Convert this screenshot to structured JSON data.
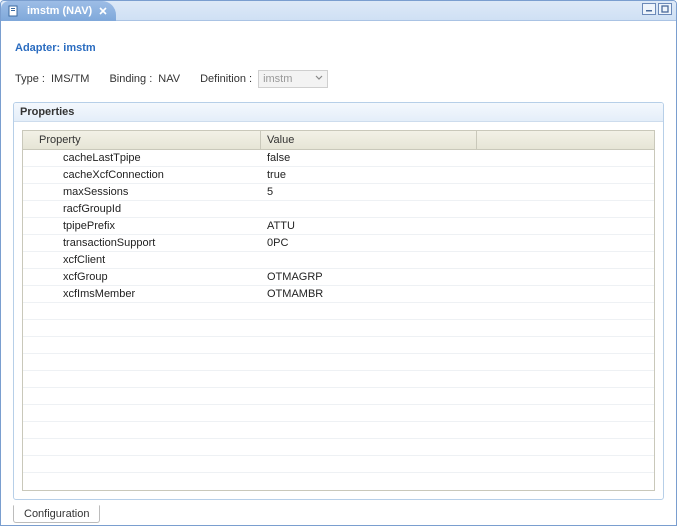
{
  "tab": {
    "title": "imstm (NAV)"
  },
  "heading_prefix": "Adapter: ",
  "heading_name": "imstm",
  "meta": {
    "type_label": "Type :",
    "type_value": "IMS/TM",
    "binding_label": "Binding :",
    "binding_value": "NAV",
    "definition_label": "Definition :",
    "definition_value": "imstm"
  },
  "panel": {
    "title": "Properties"
  },
  "columns": {
    "property": "Property",
    "value": "Value"
  },
  "rows": [
    {
      "property": "cacheLastTpipe",
      "value": "false"
    },
    {
      "property": "cacheXcfConnection",
      "value": "true"
    },
    {
      "property": "maxSessions",
      "value": "5"
    },
    {
      "property": "racfGroupId",
      "value": ""
    },
    {
      "property": "tpipePrefix",
      "value": "ATTU"
    },
    {
      "property": "transactionSupport",
      "value": "0PC"
    },
    {
      "property": "xcfClient",
      "value": ""
    },
    {
      "property": "xcfGroup",
      "value": "OTMAGRP"
    },
    {
      "property": "xcfImsMember",
      "value": "OTMAMBR"
    }
  ],
  "bottom_tab": "Configuration"
}
